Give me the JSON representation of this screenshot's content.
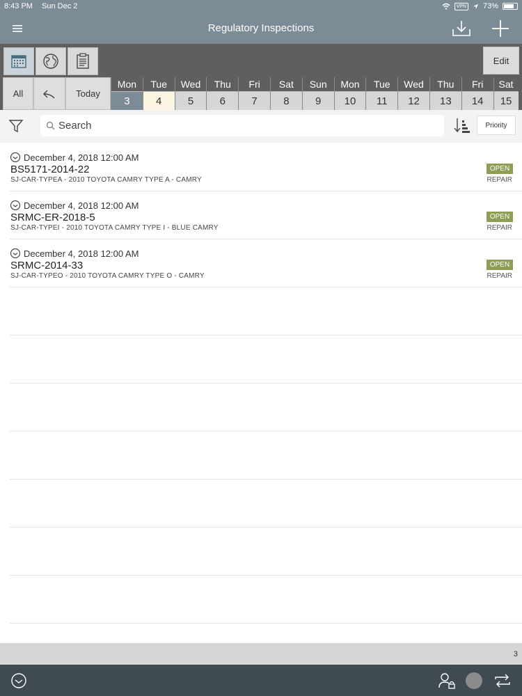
{
  "status": {
    "time": "8:43 PM",
    "date": "Sun Dec 2",
    "vpn": "VPN",
    "battery": "73%"
  },
  "nav": {
    "title": "Regulatory Inspections"
  },
  "toolbar": {
    "edit_label": "Edit"
  },
  "datestrip": {
    "all_label": "All",
    "today_label": "Today",
    "days": [
      {
        "name": "Mon",
        "num": "3"
      },
      {
        "name": "Tue",
        "num": "4"
      },
      {
        "name": "Wed",
        "num": "5"
      },
      {
        "name": "Thu",
        "num": "6"
      },
      {
        "name": "Fri",
        "num": "7"
      },
      {
        "name": "Sat",
        "num": "8"
      },
      {
        "name": "Sun",
        "num": "9"
      },
      {
        "name": "Mon",
        "num": "10"
      },
      {
        "name": "Tue",
        "num": "11"
      },
      {
        "name": "Wed",
        "num": "12"
      },
      {
        "name": "Thu",
        "num": "13"
      },
      {
        "name": "Fri",
        "num": "14"
      },
      {
        "name": "Sat",
        "num": "15"
      }
    ]
  },
  "search": {
    "placeholder": "Search",
    "sort_label": "Priority"
  },
  "inspections": [
    {
      "date": "December 4, 2018 12:00 AM",
      "id": "BS5171-2014-22",
      "desc": "SJ-CAR-TYPEA - 2010 TOYOTA CAMRY TYPE A - CAMRY",
      "status": "OPEN",
      "type": "REPAIR"
    },
    {
      "date": "December 4, 2018 12:00 AM",
      "id": "SRMC-ER-2018-5",
      "desc": "SJ-CAR-TYPEI - 2010 TOYOTA CAMRY TYPE I - BLUE CAMRY",
      "status": "OPEN",
      "type": "REPAIR"
    },
    {
      "date": "December 4, 2018 12:00 AM",
      "id": "SRMC-2014-33",
      "desc": "SJ-CAR-TYPEO - 2010 TOYOTA CAMRY TYPE O - CAMRY",
      "status": "OPEN",
      "type": "REPAIR"
    }
  ],
  "footer": {
    "count": "3"
  }
}
